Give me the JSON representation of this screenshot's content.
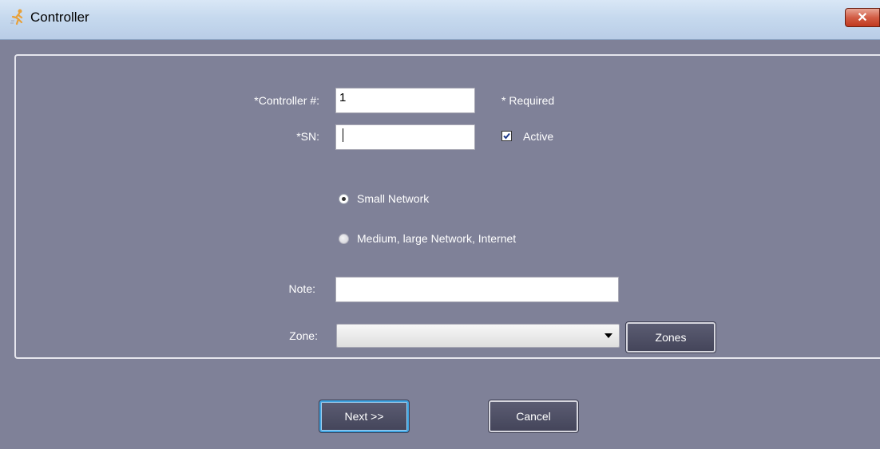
{
  "window": {
    "title": "Controller",
    "close_label": "✕",
    "icon": "app-running-man-icon"
  },
  "form": {
    "controller_label": "*Controller #:",
    "controller_value": "1",
    "required_note": "* Required",
    "sn_label": "*SN:",
    "sn_value": "",
    "active_label": "Active",
    "active_checked": true,
    "radio_small_label": "Small Network",
    "radio_small_selected": true,
    "radio_medium_label": "Medium, large Network, Internet",
    "radio_medium_selected": false,
    "note_label": "Note:",
    "note_value": "",
    "zone_label": "Zone:",
    "zone_value": "",
    "zones_button": "Zones"
  },
  "footer": {
    "next_label": "Next >>",
    "cancel_label": "Cancel"
  }
}
